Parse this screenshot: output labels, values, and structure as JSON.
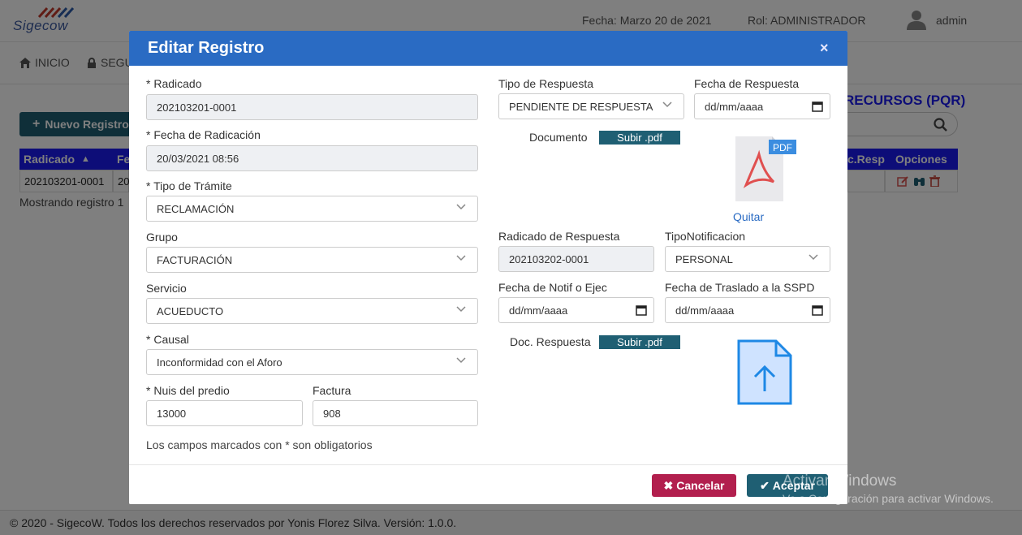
{
  "app": {
    "logo_text": "Sigecow"
  },
  "topbar": {
    "fecha": "Fecha: Marzo 20 de 2021",
    "rol": "Rol: ADMINISTRADOR",
    "user": "admin"
  },
  "nav": {
    "inicio": "INICIO",
    "seg": "SEGU"
  },
  "page": {
    "nuevo_registro": "Nuevo Registro",
    "recursos_title": "RECURSOS (PQR)",
    "table": {
      "headers": {
        "radicado": "Radicado",
        "fe": "Fe",
        "fecresp": "c.Resp",
        "opciones": "Opciones"
      },
      "row": {
        "radicado": "202103201-0001",
        "fe": "20,"
      }
    },
    "mostrando": "Mostrando registro 1"
  },
  "footer": {
    "text": "© 2020 - SigecoW. Todos los derechos reservados por Yonis Florez Silva. Versión: 1.0.0."
  },
  "modal": {
    "title": "Editar Registro",
    "close": "×",
    "radicado": {
      "label": "* Radicado",
      "value": "202103201-0001"
    },
    "fecha_radicacion": {
      "label": "* Fecha de Radicación",
      "value": "20/03/2021 08:56"
    },
    "tipo_tramite": {
      "label": "* Tipo de Trámite",
      "value": "RECLAMACIÓN"
    },
    "grupo": {
      "label": "Grupo",
      "value": "FACTURACIÓN"
    },
    "servicio": {
      "label": "Servicio",
      "value": "ACUEDUCTO"
    },
    "causal": {
      "label": "* Causal",
      "value": "Inconformidad con el Aforo"
    },
    "nuis": {
      "label": "* Nuis del predio",
      "value": "13000"
    },
    "factura": {
      "label": "Factura",
      "value": "908"
    },
    "tipo_respuesta": {
      "label": "Tipo de Respuesta",
      "value": "PENDIENTE DE RESPUESTA"
    },
    "fecha_respuesta": {
      "label": "Fecha de Respuesta",
      "value": "dd/mm/aaaa"
    },
    "documento": {
      "label": "Documento",
      "upload": "Subir .pdf",
      "pdf_badge": "PDF",
      "quitar": "Quitar"
    },
    "radicado_respuesta": {
      "label": "Radicado de Respuesta",
      "value": "202103202-0001"
    },
    "tipo_notificacion": {
      "label": "TipoNotificacion",
      "value": "PERSONAL"
    },
    "fecha_notif": {
      "label": "Fecha de Notif o Ejec",
      "value": "dd/mm/aaaa"
    },
    "fecha_traslado": {
      "label": "Fecha de Traslado a la SSPD",
      "value": "dd/mm/aaaa"
    },
    "doc_respuesta": {
      "label": "Doc. Respuesta",
      "upload": "Subir .pdf"
    },
    "required_note": "Los campos marcados con * son obligatorios",
    "cancel": "Cancelar",
    "accept": "Aceptar"
  },
  "watermark": {
    "line1": "Activar Windows",
    "line2": "Ve a Configuración para activar Windows."
  },
  "colors": {
    "header_blue": "#2a6bc3",
    "teal": "#1f5f73",
    "cancel_red": "#b21f4e",
    "table_head": "#1a1af0"
  }
}
